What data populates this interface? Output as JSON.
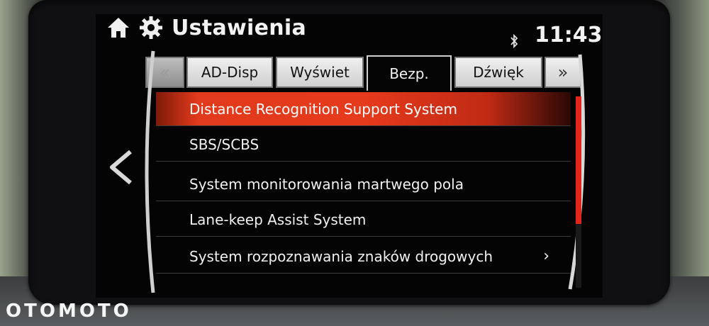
{
  "header": {
    "title": "Ustawienia",
    "time": "11:43"
  },
  "tabs": [
    {
      "label": "«"
    },
    {
      "label": "AD-Disp"
    },
    {
      "label": "Wyświet"
    },
    {
      "label": "Bezp.",
      "active": true
    },
    {
      "label": "Dźwięk"
    },
    {
      "label": "»"
    }
  ],
  "menu": {
    "items": [
      {
        "label": "Distance Recognition Support System",
        "selected": true
      },
      {
        "label": "SBS/SCBS"
      },
      {
        "label": "System monitorowania martwego pola"
      },
      {
        "label": "Lane-keep Assist System"
      },
      {
        "label": "System rozpoznawania znaków drogowych",
        "has_submenu": true
      }
    ]
  },
  "watermark": "OTOMOTO",
  "colors": {
    "accent": "#e23a1c",
    "background": "#040405",
    "text": "#f0f0f0"
  },
  "icons": [
    "home-icon",
    "gear-icon",
    "bluetooth-icon",
    "back-chevron-icon",
    "chevron-right-icon"
  ]
}
